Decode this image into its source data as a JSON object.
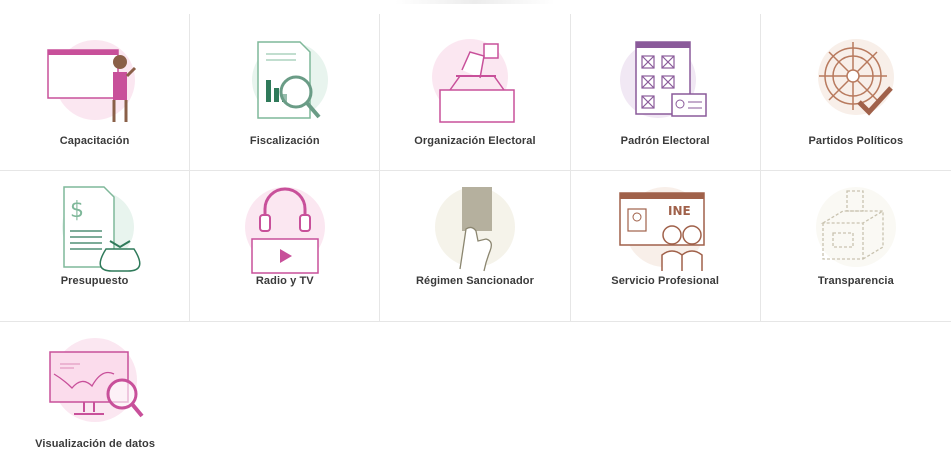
{
  "categories": [
    {
      "label": "Capacitación",
      "icon": "training-presentation-icon"
    },
    {
      "label": "Fiscalización",
      "icon": "audit-magnifier-chart-icon"
    },
    {
      "label": "Organización Electoral",
      "icon": "ballot-box-icon"
    },
    {
      "label": "Padrón Electoral",
      "icon": "voter-registry-checklist-icon"
    },
    {
      "label": "Partidos Políticos",
      "icon": "gear-check-icon"
    },
    {
      "label": "Presupuesto",
      "icon": "budget-money-bag-icon"
    },
    {
      "label": "Radio y TV",
      "icon": "headphones-play-icon"
    },
    {
      "label": "Régimen Sancionador",
      "icon": "penalty-card-icon"
    },
    {
      "label": "Servicio Profesional",
      "icon": "ine-id-card-icon"
    },
    {
      "label": "Transparencia",
      "icon": "transparent-box-icon"
    },
    {
      "label": "Visualización de datos",
      "icon": "data-visualization-monitor-icon"
    }
  ],
  "colors": {
    "accent": "#c8509a",
    "pink_bg": "#fbe7f1",
    "brown": "#a0614a"
  }
}
